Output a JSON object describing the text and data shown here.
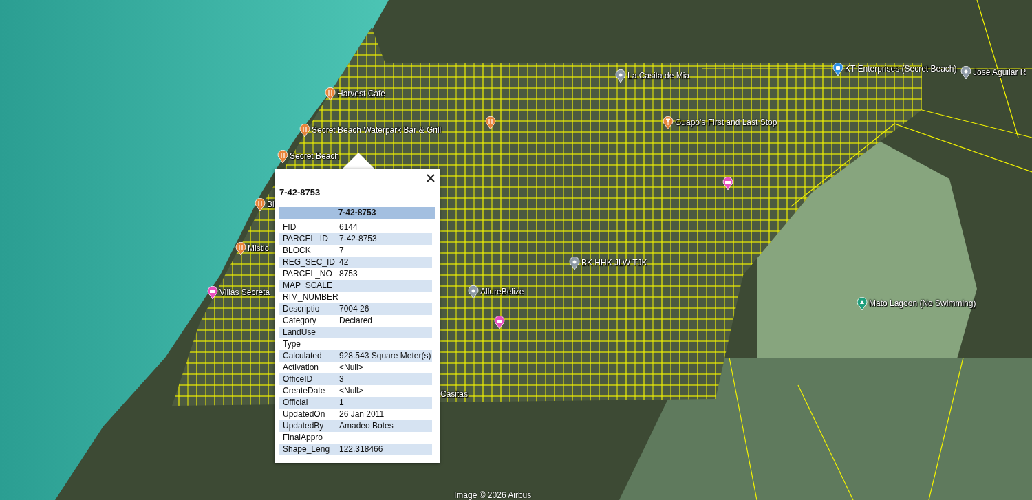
{
  "map": {
    "places": [
      {
        "label": "Harvest Cafe",
        "kind": "restaurant"
      },
      {
        "label": "Secret Beach Waterpark Bar & Grill",
        "kind": "restaurant"
      },
      {
        "label": "Secret Beach",
        "kind": "restaurant"
      },
      {
        "label": "Bl",
        "kind": "restaurant"
      },
      {
        "label": "Mistic",
        "kind": "restaurant"
      },
      {
        "label": "Villas Secreta",
        "kind": "hotel"
      },
      {
        "kind": "restaurant"
      },
      {
        "label": "La Casita de Mia",
        "kind": "place"
      },
      {
        "label": "Guapo's First and Last Stop",
        "kind": "bar"
      },
      {
        "label": "KT Enterprises (Secret Beach)",
        "kind": "shop"
      },
      {
        "label": "José Aguilar R",
        "kind": "place"
      },
      {
        "kind": "hotel"
      },
      {
        "label": "BK HHK JLW TJK",
        "kind": "place"
      },
      {
        "label": "AllureBelize",
        "kind": "place"
      },
      {
        "kind": "hotel"
      },
      {
        "label": "Mato Lagoon (No Swimming)",
        "kind": "park"
      }
    ],
    "area_labels": [
      "Casitas"
    ],
    "attribution": "Image © 2026 Airbus"
  },
  "popup": {
    "title": "7-42-8753",
    "table_header": "7-42-8753",
    "rows": [
      {
        "field": "FID",
        "value": "6144"
      },
      {
        "field": "PARCEL_ID",
        "value": "7-42-8753"
      },
      {
        "field": "BLOCK",
        "value": "7"
      },
      {
        "field": "REG_SEC_ID",
        "value": "42"
      },
      {
        "field": "PARCEL_NO",
        "value": "8753"
      },
      {
        "field": "MAP_SCALE"
      },
      {
        "field": "RIM_NUMBER"
      },
      {
        "field": "Descriptio",
        "value": "7004 26"
      },
      {
        "field": "Category",
        "value": "Declared"
      },
      {
        "field": "LandUse"
      },
      {
        "field": "Type"
      },
      {
        "field": "Calculated",
        "value": "928.543 Square Meter(s)"
      },
      {
        "field": "Activation",
        "value": "<Null>"
      },
      {
        "field": "OfficeID",
        "value": "3"
      },
      {
        "field": "CreateDate",
        "value": "<Null>"
      },
      {
        "field": "Official",
        "value": "1"
      },
      {
        "field": "UpdatedOn",
        "value": "26 Jan 2011"
      },
      {
        "field": "UpdatedBy",
        "value": "Amadeo Botes"
      },
      {
        "field": "FinalAppro"
      },
      {
        "field": "Shape_Leng",
        "value": "122.318466"
      }
    ]
  }
}
